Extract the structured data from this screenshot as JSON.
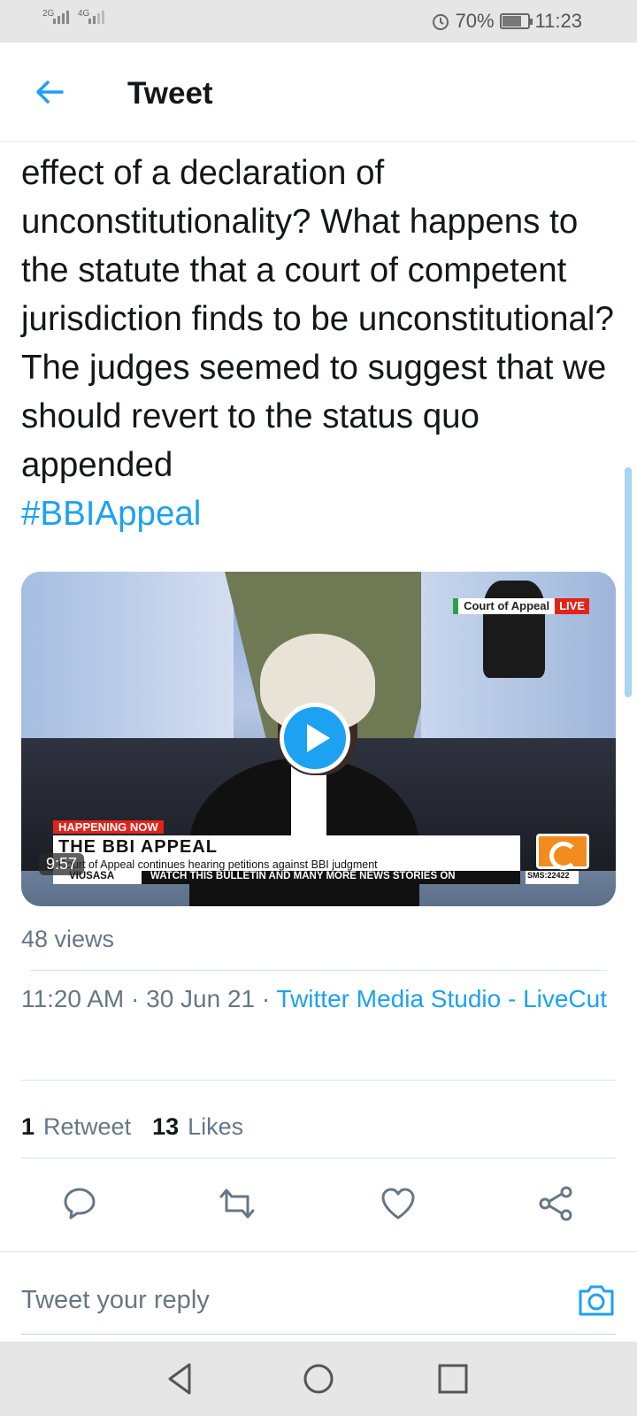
{
  "status_bar": {
    "signal_1": "2G",
    "signal_2": "4G",
    "battery": "70%",
    "time": "11:23"
  },
  "header": {
    "title": "Tweet"
  },
  "tweet": {
    "cut_line_text": "",
    "text": "effect of a declaration of unconstitutionality? What happens to the statute that a court of competent jurisdiction finds to be unconstitutional? The judges seemed to suggest that we should revert to the status quo appended",
    "hashtag": "#BBIAppeal"
  },
  "media": {
    "court_tag": "Court of Appeal",
    "live_tag": "LIVE",
    "happening": "HAPPENING NOW",
    "headline": "THE BBI APPEAL",
    "subline": "Court of Appeal continues hearing petitions against BBI judgment",
    "ticker_left": "VIUSASA",
    "ticker_main": "WATCH THIS BULLETIN AND MANY MORE NEWS STORIES ON",
    "ticker_sms": "SMS:22422",
    "duration": "9:57"
  },
  "views": "48 views",
  "meta": {
    "time": "11:20 AM",
    "date": "30 Jun 21",
    "source": "Twitter Media Studio - LiveCut"
  },
  "stats": {
    "retweets_count": "1",
    "retweets_label": "Retweet",
    "likes_count": "13",
    "likes_label": "Likes"
  },
  "actions": {
    "reply_icon": "comment-icon",
    "retweet_icon": "retweet-icon",
    "like_icon": "heart-icon",
    "share_icon": "share-icon"
  },
  "reply_box": {
    "placeholder": "Tweet your reply",
    "camera_icon": "camera-icon"
  },
  "colors": {
    "accent": "#1da1f2",
    "secondary_text": "#657786"
  }
}
